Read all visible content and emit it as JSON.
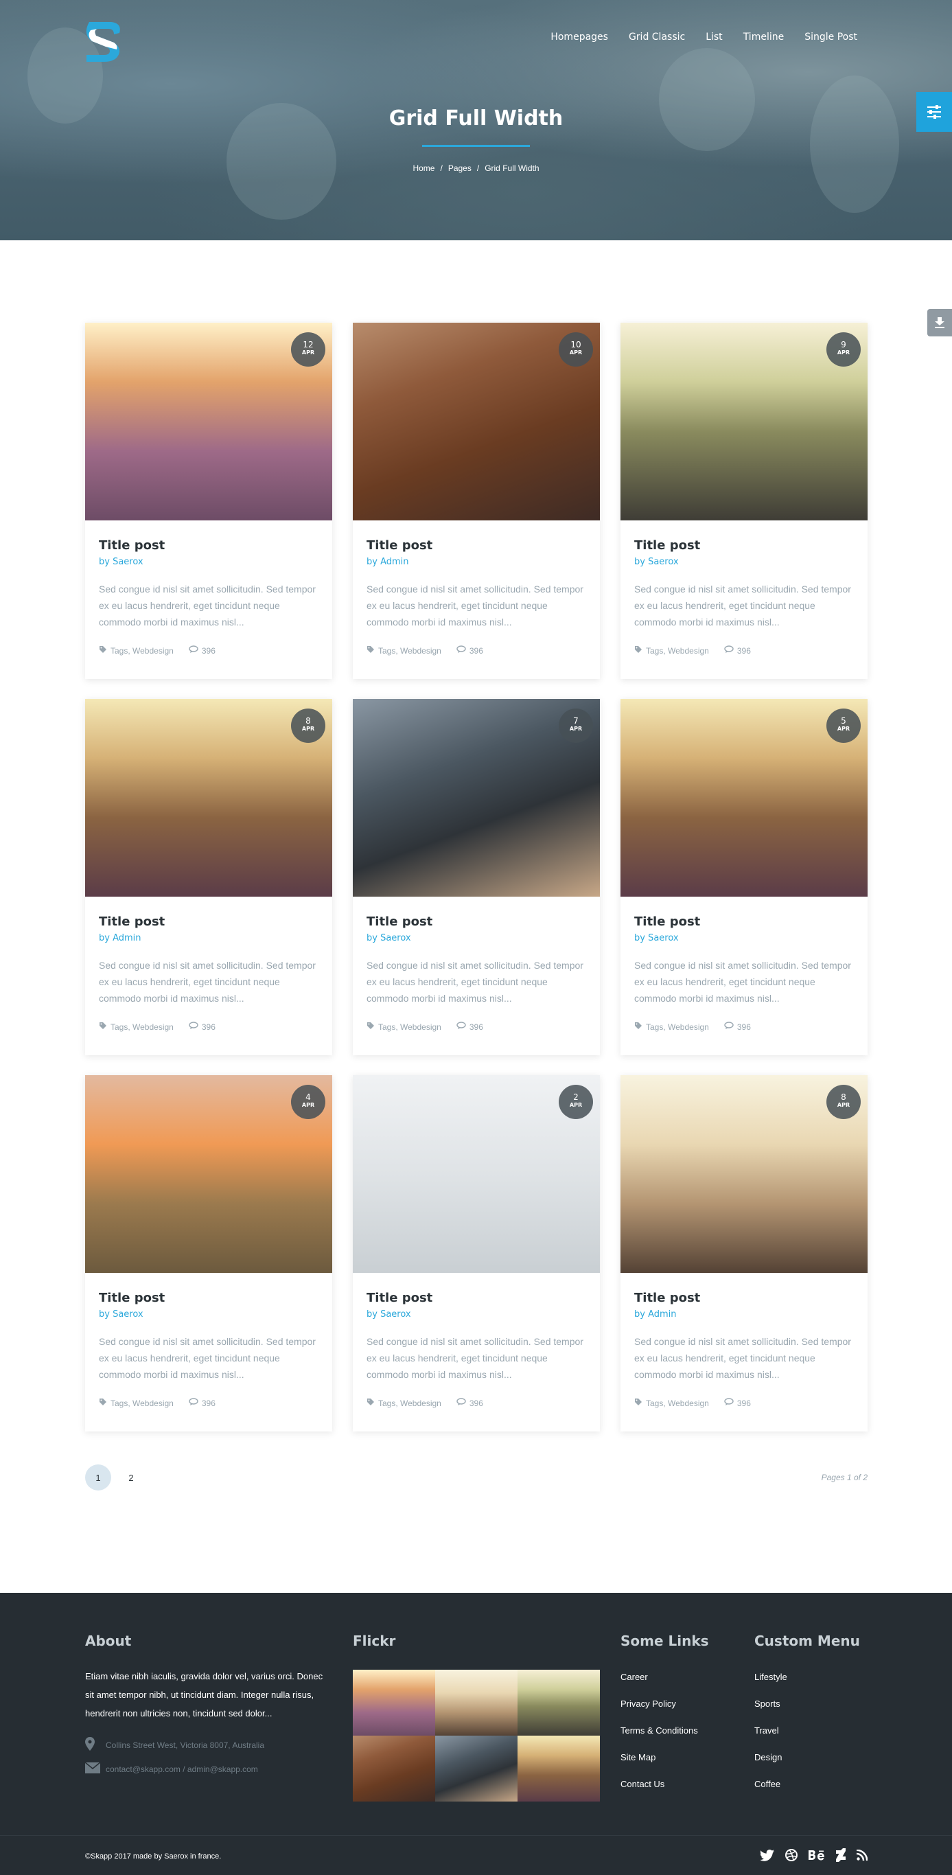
{
  "nav": {
    "items": [
      "Homepages",
      "Grid Classic",
      "List",
      "Timeline",
      "Single Post"
    ]
  },
  "hero": {
    "title": "Grid Full Width",
    "breadcrumb": [
      "Home",
      "Pages",
      "Grid Full Width"
    ],
    "separator": "/"
  },
  "colors": {
    "accent": "#2ba8db",
    "footer_bg": "#262d33"
  },
  "posts": [
    {
      "day": "12",
      "month": "APR",
      "title": "Title post",
      "by": "by",
      "author": "Saerox",
      "excerpt": "Sed congue id nisl sit amet sollicitudin. Sed tempor ex eu lacus hendrerit, eget tincidunt neque commodo morbi id maximus nisl...",
      "tags": "Tags, Webdesign",
      "comments": "396",
      "image": "g-street"
    },
    {
      "day": "10",
      "month": "APR",
      "title": "Title post",
      "by": "by",
      "author": "Admin",
      "excerpt": "Sed congue id nisl sit amet sollicitudin. Sed tempor ex eu lacus hendrerit, eget tincidunt neque commodo morbi id maximus nisl...",
      "tags": "Tags, Webdesign",
      "comments": "396",
      "image": "g-redhead"
    },
    {
      "day": "9",
      "month": "APR",
      "title": "Title post",
      "by": "by",
      "author": "Saerox",
      "excerpt": "Sed congue id nisl sit amet sollicitudin. Sed tempor ex eu lacus hendrerit, eget tincidunt neque commodo morbi id maximus nisl...",
      "tags": "Tags, Webdesign",
      "comments": "396",
      "image": "g-moto"
    },
    {
      "day": "8",
      "month": "APR",
      "title": "Title post",
      "by": "by",
      "author": "Admin",
      "excerpt": "Sed congue id nisl sit amet sollicitudin. Sed tempor ex eu lacus hendrerit, eget tincidunt neque commodo morbi id maximus nisl...",
      "tags": "Tags, Webdesign",
      "comments": "396",
      "image": "g-road"
    },
    {
      "day": "7",
      "month": "APR",
      "title": "Title post",
      "by": "by",
      "author": "Saerox",
      "excerpt": "Sed congue id nisl sit amet sollicitudin. Sed tempor ex eu lacus hendrerit, eget tincidunt neque commodo morbi id maximus nisl...",
      "tags": "Tags, Webdesign",
      "comments": "396",
      "image": "g-coffee"
    },
    {
      "day": "5",
      "month": "APR",
      "title": "Title post",
      "by": "by",
      "author": "Saerox",
      "excerpt": "Sed congue id nisl sit amet sollicitudin. Sed tempor ex eu lacus hendrerit, eget tincidunt neque commodo morbi id maximus nisl...",
      "tags": "Tags, Webdesign",
      "comments": "396",
      "image": "g-road"
    },
    {
      "day": "4",
      "month": "APR",
      "title": "Title post",
      "by": "by",
      "author": "Saerox",
      "excerpt": "Sed congue id nisl sit amet sollicitudin. Sed tempor ex eu lacus hendrerit, eget tincidunt neque commodo morbi id maximus nisl...",
      "tags": "Tags, Webdesign",
      "comments": "396",
      "image": "g-hike"
    },
    {
      "day": "2",
      "month": "APR",
      "title": "Title post",
      "by": "by",
      "author": "Saerox",
      "excerpt": "Sed congue id nisl sit amet sollicitudin. Sed tempor ex eu lacus hendrerit, eget tincidunt neque commodo morbi id maximus nisl...",
      "tags": "Tags, Webdesign",
      "comments": "396",
      "image": "g-dance"
    },
    {
      "day": "8",
      "month": "APR",
      "title": "Title post",
      "by": "by",
      "author": "Admin",
      "excerpt": "Sed congue id nisl sit amet sollicitudin. Sed tempor ex eu lacus hendrerit, eget tincidunt neque commodo morbi id maximus nisl...",
      "tags": "Tags, Webdesign",
      "comments": "396",
      "image": "g-run"
    }
  ],
  "pagination": {
    "pages": [
      "1",
      "2"
    ],
    "current": "1",
    "info": "Pages 1 of 2"
  },
  "footer": {
    "about": {
      "title": "About",
      "text": "Etiam vitae nibh iaculis, gravida dolor vel, varius orci. Donec sit amet tempor nibh, ut tincidunt diam. Integer nulla risus, hendrerit non ultricies non, tincidunt sed dolor...",
      "address": "Collins Street West, Victoria 8007, Australia",
      "email": "contact@skapp.com / admin@skapp.com"
    },
    "flickr": {
      "title": "Flickr",
      "images": [
        "g-street",
        "g-run",
        "g-moto",
        "g-redhead",
        "g-coffee",
        "g-road"
      ]
    },
    "links": {
      "title": "Some Links",
      "items": [
        "Career",
        "Privacy Policy",
        "Terms & Conditions",
        "Site Map",
        "Contact Us"
      ]
    },
    "custom_menu": {
      "title": "Custom Menu",
      "items": [
        "Lifestyle",
        "Sports",
        "Travel",
        "Design",
        "Coffee"
      ]
    },
    "copyright": "©Skapp 2017 made by Saerox in france.",
    "social_icons": [
      "twitter-icon",
      "dribbble-icon",
      "behance-icon",
      "deviantart-icon",
      "rss-icon"
    ]
  }
}
